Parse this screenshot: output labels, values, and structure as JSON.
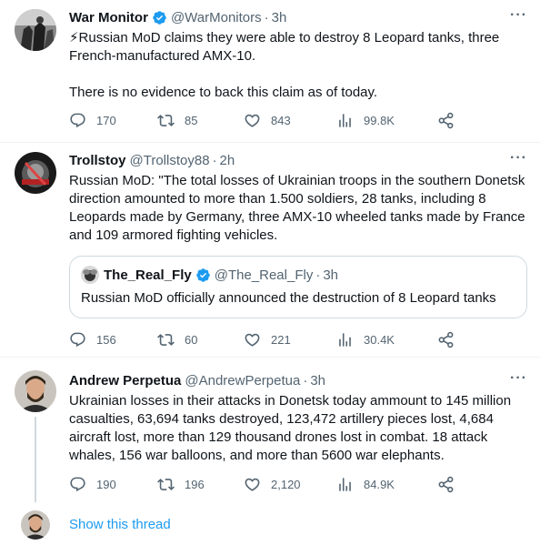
{
  "tweets": [
    {
      "name": "War Monitor",
      "handle": "@WarMonitors",
      "time": "3h",
      "text_lines": [
        "⚡Russian MoD claims they were able to destroy 8 Leopard tanks, three French-manufactured AMX-10.",
        "There is no evidence to back this claim as of today."
      ],
      "replies": "170",
      "retweets": "85",
      "likes": "843",
      "views": "99.8K"
    },
    {
      "name": "Trollstoy",
      "handle": "@Trollstoy88",
      "time": "2h",
      "text": "Russian MoD: \"The total losses of Ukrainian troops in the southern Donetsk direction amounted to more than 1.500 soldiers, 28 tanks, including 8 Leopards made by Germany, three AMX-10 wheeled tanks made by France and 109 armored fighting vehicles.",
      "quote": {
        "name": "The_Real_Fly",
        "handle": "@The_Real_Fly",
        "time": "3h",
        "text": "Russian MoD officially announced the destruction of 8 Leopard tanks"
      },
      "replies": "156",
      "retweets": "60",
      "likes": "221",
      "views": "30.4K"
    },
    {
      "name": "Andrew Perpetua",
      "handle": "@AndrewPerpetua",
      "time": "3h",
      "text": "Ukrainian losses in their attacks in Donetsk today ammount to 145 million casualties, 63,694 tanks destroyed, 123,472 artillery pieces lost, 4,684 aircraft lost, more than 129 thousand drones lost in combat. 18 attack whales, 156 war balloons, and more than 5600 war elephants.",
      "replies": "190",
      "retweets": "196",
      "likes": "2,120",
      "views": "84.9K"
    }
  ],
  "show_thread": "Show this thread",
  "more_label": "···",
  "dot": "·",
  "colors": {
    "accent": "#1d9bf0",
    "muted": "#536471",
    "text": "#0f1419"
  }
}
